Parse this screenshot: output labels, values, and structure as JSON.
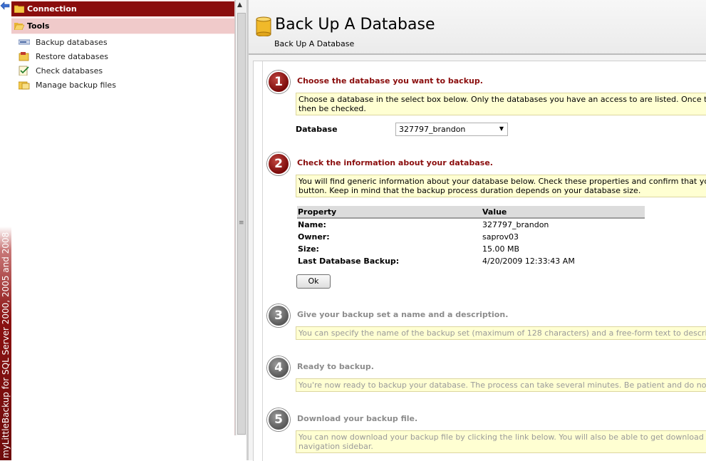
{
  "branding": {
    "text": "myLittleBackup for SQL Server 2000, 2005 and 2008"
  },
  "sidebar": {
    "connection_label": "Connection",
    "tools_label": "Tools",
    "items": [
      {
        "label": "Backup databases",
        "icon": "backup-icon"
      },
      {
        "label": "Restore databases",
        "icon": "restore-icon"
      },
      {
        "label": "Check databases",
        "icon": "check-icon"
      },
      {
        "label": "Manage backup files",
        "icon": "manage-files-icon"
      }
    ]
  },
  "header": {
    "title": "Back Up A Database",
    "subtitle": "Back Up A Database"
  },
  "steps": [
    {
      "number": "1",
      "title": "Choose the database you want to backup.",
      "info": "Choose a database in the select box below. Only the databases you have an access to are listed. Once the database has been selected, its information will then be checked.",
      "info_line1": "Choose a database in the select box below. Only the databases you have an access to are listed. Once the database h",
      "info_line2": "then be checked.",
      "active": true
    },
    {
      "number": "2",
      "title": "Check the information about your database.",
      "info_line1": "You will find generic information about your database below. Check these properties and confirm that you really want to",
      "info_line2": "button. Keep in mind that the backup process duration depends on your database size.",
      "active": true
    },
    {
      "number": "3",
      "title": "Give your backup set a name and a description.",
      "info_line1": "You can specify the name of the backup set (maximum of 128 characters) and a free-form text to describe the backup s",
      "active": false
    },
    {
      "number": "4",
      "title": "Ready to backup.",
      "info_line1": "You're now ready to backup your database. The process can take several minutes. Be patient and do not click the stop",
      "active": false
    },
    {
      "number": "5",
      "title": "Download your backup file.",
      "info_line1": "You can now download your backup file by clicking the link below. You will also be able to get download the backup file fr",
      "info_line2": "navigation sidebar.",
      "active": false
    }
  ],
  "database_select": {
    "label": "Database",
    "value": "327797_brandon"
  },
  "properties": {
    "headers": [
      "Property",
      "Value"
    ],
    "rows": [
      [
        "Name:",
        "327797_brandon"
      ],
      [
        "Owner:",
        "saprov03"
      ],
      [
        "Size:",
        "15.00 MB"
      ],
      [
        "Last Database Backup:",
        "4/20/2009 12:33:43 AM"
      ]
    ]
  },
  "ok_label": "Ok",
  "colors": {
    "accent": "#8a0d0d",
    "info_bg": "#ffffd2",
    "inactive": "#8c8c8c"
  }
}
